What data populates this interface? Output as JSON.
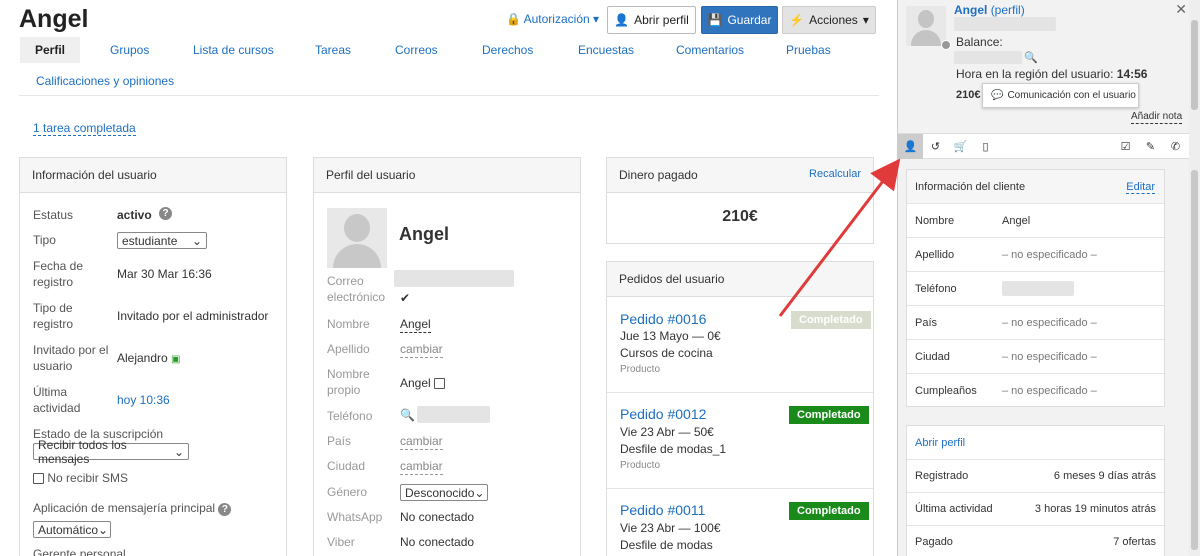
{
  "header": {
    "title": "Angel",
    "authorization": "Autorización",
    "open_profile": "Abrir perfil",
    "save": "Guardar",
    "actions": "Acciones"
  },
  "tabs": [
    "Perfil",
    "Grupos",
    "Lista de cursos",
    "Tareas",
    "Correos",
    "Derechos",
    "Encuestas",
    "Comentarios",
    "Pruebas",
    "Calificaciones y opiniones"
  ],
  "task_link": "1 tarea completada",
  "user_info": {
    "heading": "Información del usuario",
    "status_label": "Estatus",
    "status_value": "activo",
    "type_label": "Tipo",
    "type_value": "estudiante",
    "reg_date_label": "Fecha de registro",
    "reg_date_value": "Mar 30 Mar 16:36",
    "reg_type_label": "Tipo de registro",
    "reg_type_value": "Invitado por el administrador",
    "invited_by_label": "Invitado por el usuario",
    "invited_by_value": "Alejandro",
    "last_activity_label": "Última actividad",
    "last_activity_value": "hoy 10:36",
    "subscription_label": "Estado de la suscripción",
    "subscription_value": "Recibir todos los mensajes",
    "no_sms": "No recibir SMS",
    "messenger_label": "Aplicación de mensajería principal",
    "messenger_value": "Automático",
    "manager_label": "Gerente personal"
  },
  "user_profile": {
    "heading": "Perfil del usuario",
    "name_big": "Angel",
    "email_label": "Correo electrónico",
    "name_label": "Nombre",
    "name_value": "Angel",
    "surname_label": "Apellido",
    "surname_value": "cambiar",
    "own_name_label": "Nombre propio",
    "own_name_value": "Angel",
    "phone_label": "Teléfono",
    "country_label": "País",
    "country_value": "cambiar",
    "city_label": "Ciudad",
    "city_value": "cambiar",
    "gender_label": "Género",
    "gender_value": "Desconocido",
    "whatsapp_label": "WhatsApp",
    "whatsapp_value": "No conectado",
    "viber_label": "Viber",
    "viber_value": "No conectado"
  },
  "money": {
    "heading": "Dinero pagado",
    "recalc": "Recalcular",
    "amount": "210€"
  },
  "orders": {
    "heading": "Pedidos del usuario",
    "items": [
      {
        "title": "Pedido #0016",
        "line1": "Jue 13 Mayo — 0€",
        "line2": "Cursos de cocina",
        "meta": "Producto",
        "status": "Completado"
      },
      {
        "title": "Pedido #0012",
        "line1": "Vie 23 Abr — 50€",
        "line2": "Desfile de modas_1",
        "meta": "Producto",
        "status": "Completado"
      },
      {
        "title": "Pedido #0011",
        "line1": "Vie 23 Abr — 100€",
        "line2": "Desfile de modas",
        "meta": "",
        "status": "Completado"
      }
    ]
  },
  "side": {
    "name": "Angel",
    "perfil": "(perfil)",
    "balance": "Balance:",
    "hour_label": "Hora en la región del usuario:",
    "hour_value": "14:56",
    "amount": "210€",
    "tooltip": "Comunicación con el usuario",
    "add_note": "Añadir nota",
    "client_info": {
      "heading": "Información del cliente",
      "edit": "Editar",
      "rows": [
        {
          "k": "Nombre",
          "v": "Angel"
        },
        {
          "k": "Apellido",
          "v": "– no especificado –"
        },
        {
          "k": "Teléfono",
          "v": ""
        },
        {
          "k": "País",
          "v": "– no especificado –"
        },
        {
          "k": "Ciudad",
          "v": "– no especificado –"
        },
        {
          "k": "Cumpleaños",
          "v": "– no especificado –"
        }
      ]
    },
    "stats": {
      "open_profile": "Abrir perfil",
      "rows": [
        {
          "k": "Registrado",
          "v": "6 meses 9 días atrás"
        },
        {
          "k": "Última actividad",
          "v": "3 horas 19 minutos atrás"
        },
        {
          "k": "Pagado",
          "v": "7 ofertas"
        }
      ]
    }
  },
  "colors": {
    "accent": "#1e6fc2",
    "success": "#1a8a1a",
    "arrow": "#e03a3a"
  }
}
